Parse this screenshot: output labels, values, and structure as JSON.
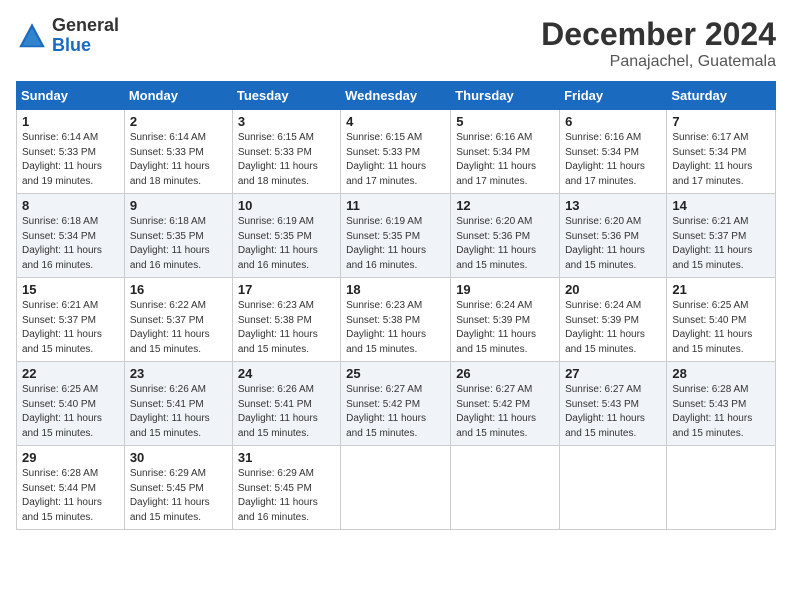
{
  "header": {
    "logo_general": "General",
    "logo_blue": "Blue",
    "month_year": "December 2024",
    "location": "Panajachel, Guatemala"
  },
  "days_of_week": [
    "Sunday",
    "Monday",
    "Tuesday",
    "Wednesday",
    "Thursday",
    "Friday",
    "Saturday"
  ],
  "weeks": [
    [
      {
        "day": "1",
        "sunrise": "6:14 AM",
        "sunset": "5:33 PM",
        "daylight": "11 hours and 19 minutes."
      },
      {
        "day": "2",
        "sunrise": "6:14 AM",
        "sunset": "5:33 PM",
        "daylight": "11 hours and 18 minutes."
      },
      {
        "day": "3",
        "sunrise": "6:15 AM",
        "sunset": "5:33 PM",
        "daylight": "11 hours and 18 minutes."
      },
      {
        "day": "4",
        "sunrise": "6:15 AM",
        "sunset": "5:33 PM",
        "daylight": "11 hours and 17 minutes."
      },
      {
        "day": "5",
        "sunrise": "6:16 AM",
        "sunset": "5:34 PM",
        "daylight": "11 hours and 17 minutes."
      },
      {
        "day": "6",
        "sunrise": "6:16 AM",
        "sunset": "5:34 PM",
        "daylight": "11 hours and 17 minutes."
      },
      {
        "day": "7",
        "sunrise": "6:17 AM",
        "sunset": "5:34 PM",
        "daylight": "11 hours and 17 minutes."
      }
    ],
    [
      {
        "day": "8",
        "sunrise": "6:18 AM",
        "sunset": "5:34 PM",
        "daylight": "11 hours and 16 minutes."
      },
      {
        "day": "9",
        "sunrise": "6:18 AM",
        "sunset": "5:35 PM",
        "daylight": "11 hours and 16 minutes."
      },
      {
        "day": "10",
        "sunrise": "6:19 AM",
        "sunset": "5:35 PM",
        "daylight": "11 hours and 16 minutes."
      },
      {
        "day": "11",
        "sunrise": "6:19 AM",
        "sunset": "5:35 PM",
        "daylight": "11 hours and 16 minutes."
      },
      {
        "day": "12",
        "sunrise": "6:20 AM",
        "sunset": "5:36 PM",
        "daylight": "11 hours and 15 minutes."
      },
      {
        "day": "13",
        "sunrise": "6:20 AM",
        "sunset": "5:36 PM",
        "daylight": "11 hours and 15 minutes."
      },
      {
        "day": "14",
        "sunrise": "6:21 AM",
        "sunset": "5:37 PM",
        "daylight": "11 hours and 15 minutes."
      }
    ],
    [
      {
        "day": "15",
        "sunrise": "6:21 AM",
        "sunset": "5:37 PM",
        "daylight": "11 hours and 15 minutes."
      },
      {
        "day": "16",
        "sunrise": "6:22 AM",
        "sunset": "5:37 PM",
        "daylight": "11 hours and 15 minutes."
      },
      {
        "day": "17",
        "sunrise": "6:23 AM",
        "sunset": "5:38 PM",
        "daylight": "11 hours and 15 minutes."
      },
      {
        "day": "18",
        "sunrise": "6:23 AM",
        "sunset": "5:38 PM",
        "daylight": "11 hours and 15 minutes."
      },
      {
        "day": "19",
        "sunrise": "6:24 AM",
        "sunset": "5:39 PM",
        "daylight": "11 hours and 15 minutes."
      },
      {
        "day": "20",
        "sunrise": "6:24 AM",
        "sunset": "5:39 PM",
        "daylight": "11 hours and 15 minutes."
      },
      {
        "day": "21",
        "sunrise": "6:25 AM",
        "sunset": "5:40 PM",
        "daylight": "11 hours and 15 minutes."
      }
    ],
    [
      {
        "day": "22",
        "sunrise": "6:25 AM",
        "sunset": "5:40 PM",
        "daylight": "11 hours and 15 minutes."
      },
      {
        "day": "23",
        "sunrise": "6:26 AM",
        "sunset": "5:41 PM",
        "daylight": "11 hours and 15 minutes."
      },
      {
        "day": "24",
        "sunrise": "6:26 AM",
        "sunset": "5:41 PM",
        "daylight": "11 hours and 15 minutes."
      },
      {
        "day": "25",
        "sunrise": "6:27 AM",
        "sunset": "5:42 PM",
        "daylight": "11 hours and 15 minutes."
      },
      {
        "day": "26",
        "sunrise": "6:27 AM",
        "sunset": "5:42 PM",
        "daylight": "11 hours and 15 minutes."
      },
      {
        "day": "27",
        "sunrise": "6:27 AM",
        "sunset": "5:43 PM",
        "daylight": "11 hours and 15 minutes."
      },
      {
        "day": "28",
        "sunrise": "6:28 AM",
        "sunset": "5:43 PM",
        "daylight": "11 hours and 15 minutes."
      }
    ],
    [
      {
        "day": "29",
        "sunrise": "6:28 AM",
        "sunset": "5:44 PM",
        "daylight": "11 hours and 15 minutes."
      },
      {
        "day": "30",
        "sunrise": "6:29 AM",
        "sunset": "5:45 PM",
        "daylight": "11 hours and 15 minutes."
      },
      {
        "day": "31",
        "sunrise": "6:29 AM",
        "sunset": "5:45 PM",
        "daylight": "11 hours and 16 minutes."
      },
      null,
      null,
      null,
      null
    ]
  ],
  "labels": {
    "sunrise": "Sunrise:",
    "sunset": "Sunset:",
    "daylight": "Daylight:"
  }
}
